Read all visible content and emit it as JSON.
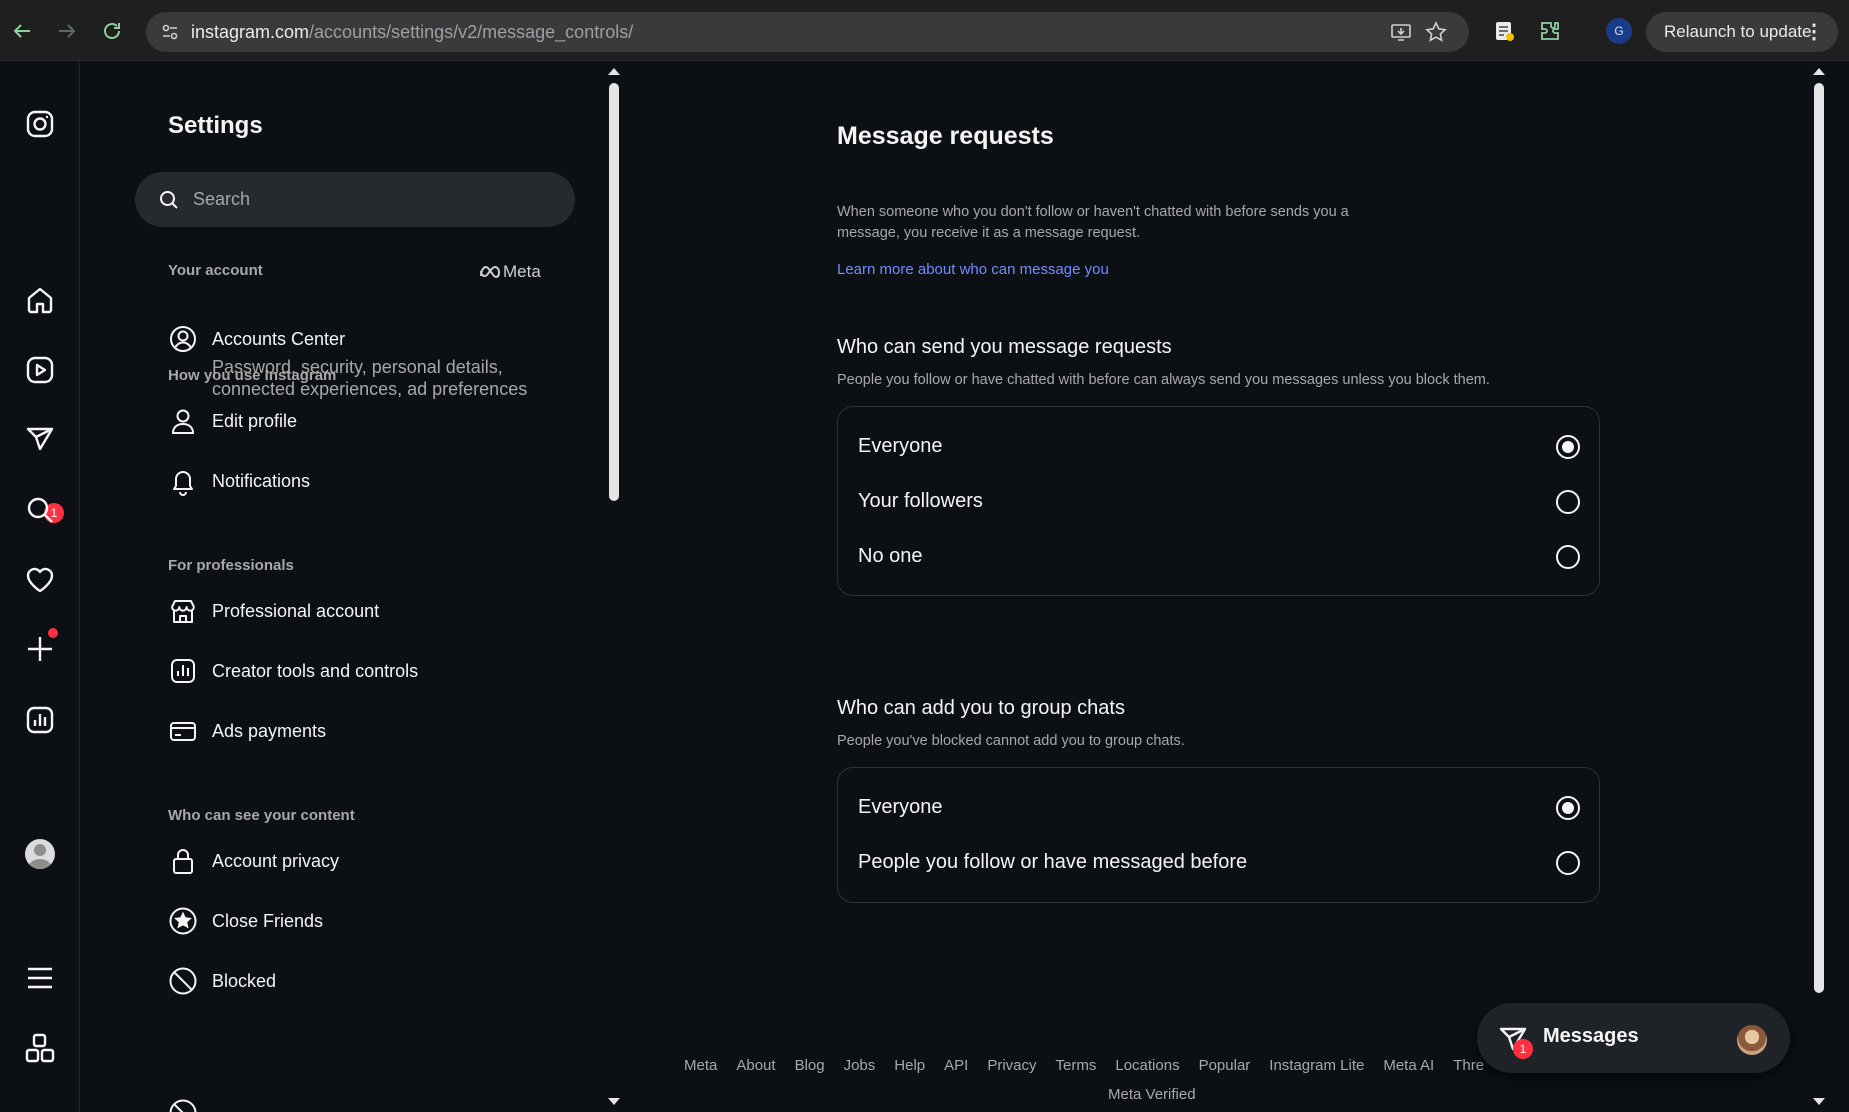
{
  "browser": {
    "url_host": "instagram.com",
    "url_path": "/accounts/settings/v2/message_controls/",
    "profile_initial": "G",
    "relaunch_label": "Relaunch to update"
  },
  "nav": {
    "notification_badge": "1"
  },
  "settings": {
    "title": "Settings",
    "search_placeholder": "Search",
    "sections": {
      "your_account": "Your account",
      "meta_logo": "Meta",
      "how_you_use": "How you use Instagram",
      "for_professionals": "For professionals",
      "who_can_see": "Who can see your content"
    },
    "items": {
      "accounts_center": "Accounts Center",
      "accounts_center_sub": "Password, security, personal details, connected experiences, ad preferences",
      "edit_profile": "Edit profile",
      "notifications": "Notifications",
      "professional_account": "Professional account",
      "creator_tools": "Creator tools and controls",
      "ads_payments": "Ads payments",
      "account_privacy": "Account privacy",
      "close_friends": "Close Friends",
      "blocked": "Blocked"
    }
  },
  "main": {
    "title": "Message requests",
    "description": "When someone who you don't follow or haven't chatted with before sends you a message, you receive it as a message request.",
    "learn_more": "Learn more about who can message you",
    "section1": {
      "title": "Who can send you message requests",
      "subtitle": "People you follow or have chatted with before can always send you messages unless you block them.",
      "options": [
        "Everyone",
        "Your followers",
        "No one"
      ],
      "selected": 0
    },
    "section2": {
      "title": "Who can add you to group chats",
      "subtitle": "People you've blocked cannot add you to group chats.",
      "options": [
        "Everyone",
        "People you follow or have messaged before"
      ],
      "selected": 0
    }
  },
  "footer": {
    "links": [
      "Meta",
      "About",
      "Blog",
      "Jobs",
      "Help",
      "API",
      "Privacy",
      "Terms",
      "Locations",
      "Popular",
      "Instagram Lite",
      "Meta AI",
      "Thre"
    ],
    "line2": "Meta Verified"
  },
  "messages_pill": {
    "label": "Messages",
    "badge": "1"
  }
}
